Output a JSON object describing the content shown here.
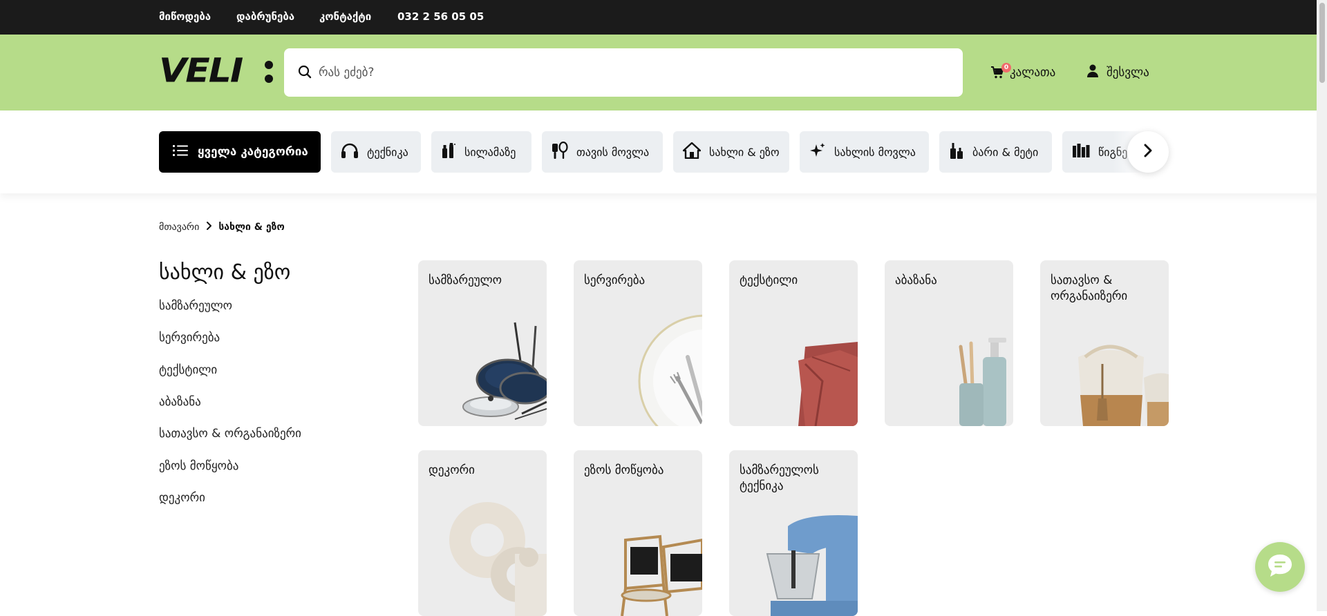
{
  "topbar": {
    "links": [
      "მიწოდება",
      "დაბრუნება",
      "კონტაქტი"
    ],
    "phone": "032 2 56 05 05"
  },
  "header": {
    "logo_text": "VELI:",
    "search_placeholder": "რას ეძებ?",
    "cart_label": "კალათა",
    "cart_count": "0",
    "login_label": "შესვლა",
    "accent_color": "#b6dc89"
  },
  "categories": {
    "all_label": "ყველა კატეგორია",
    "items": [
      {
        "label": "ტექნიკა",
        "icon": "headphones-icon"
      },
      {
        "label": "სილამაზე",
        "icon": "cosmetics-icon"
      },
      {
        "label": "თავის მოვლა",
        "icon": "hair-care-icon"
      },
      {
        "label": "სახლი & ეზო",
        "icon": "house-icon"
      },
      {
        "label": "სახლის მოვლა",
        "icon": "sparkle-icon"
      },
      {
        "label": "ბარი & მეტი",
        "icon": "bottles-icon"
      },
      {
        "label": "წიგნები",
        "icon": "books-icon"
      }
    ]
  },
  "breadcrumb": {
    "home": "მთავარი",
    "current": "სახლი & ეზო"
  },
  "page": {
    "title": "სახლი & ეზო"
  },
  "sidebar": {
    "items": [
      "სამზარეულო",
      "სერვირება",
      "ტექსტილი",
      "აბაზანა",
      "სათავსო & ორგანაიზერი",
      "ეზოს მოწყობა",
      "დეკორი"
    ]
  },
  "subcategories": [
    {
      "title": "სამზარეულო",
      "image": "cookware-pans-image"
    },
    {
      "title": "სერვირება",
      "image": "plate-cutlery-image"
    },
    {
      "title": "ტექსტილი",
      "image": "red-towel-image"
    },
    {
      "title": "აბაზანა",
      "image": "soap-dispenser-image"
    },
    {
      "title": "სათავსო & ორგანაიზერი",
      "image": "woven-basket-image"
    },
    {
      "title": "დეკორი",
      "image": "ceramic-vase-image"
    },
    {
      "title": "ეზოს მოწყობა",
      "image": "rattan-chairs-image"
    },
    {
      "title": "სამზარეულოს ტექნიკა",
      "image": "stand-mixer-image"
    }
  ]
}
